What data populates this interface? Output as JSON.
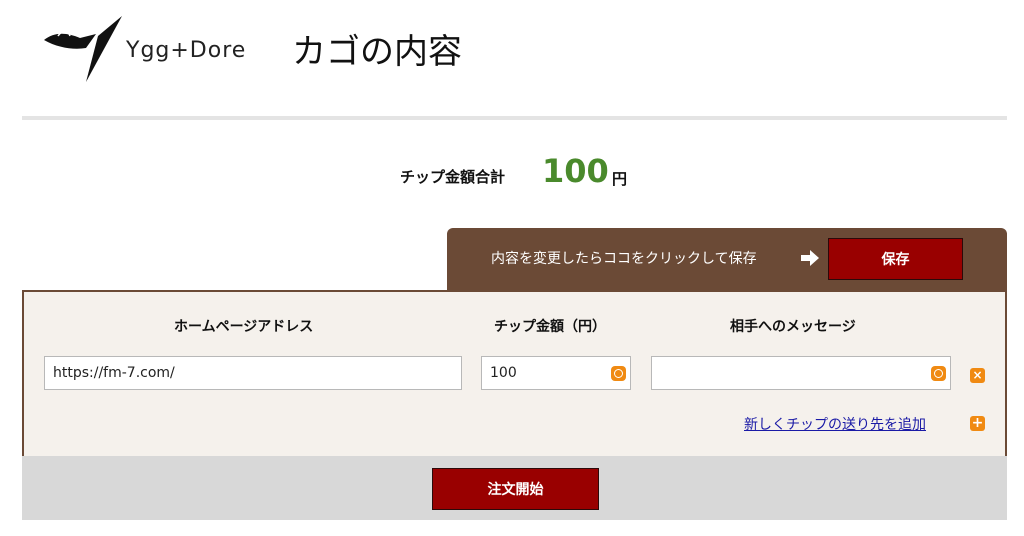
{
  "header": {
    "logo_text": "Ygg+Dore",
    "page_title": "カゴの内容"
  },
  "summary": {
    "label": "チップ金額合計",
    "value": "100",
    "unit": "円",
    "value_color": "#4a8a2c"
  },
  "save_bar": {
    "hint": "内容を変更したらココをクリックして保存",
    "save_label": "保存",
    "arrow_icon": "arrow-right-icon"
  },
  "form": {
    "columns": [
      "ホームページアドレス",
      "チップ金額（円）",
      "相手へのメッセージ"
    ],
    "rows": [
      {
        "url": "https://fm-7.com/",
        "amount": "100",
        "message": ""
      }
    ],
    "add_link": "新しくチップの送り先を追加"
  },
  "footer": {
    "order_label": "注文開始"
  },
  "colors": {
    "accent_brown": "#6b4a36",
    "button_red": "#990000",
    "icon_orange": "#f08a12"
  }
}
